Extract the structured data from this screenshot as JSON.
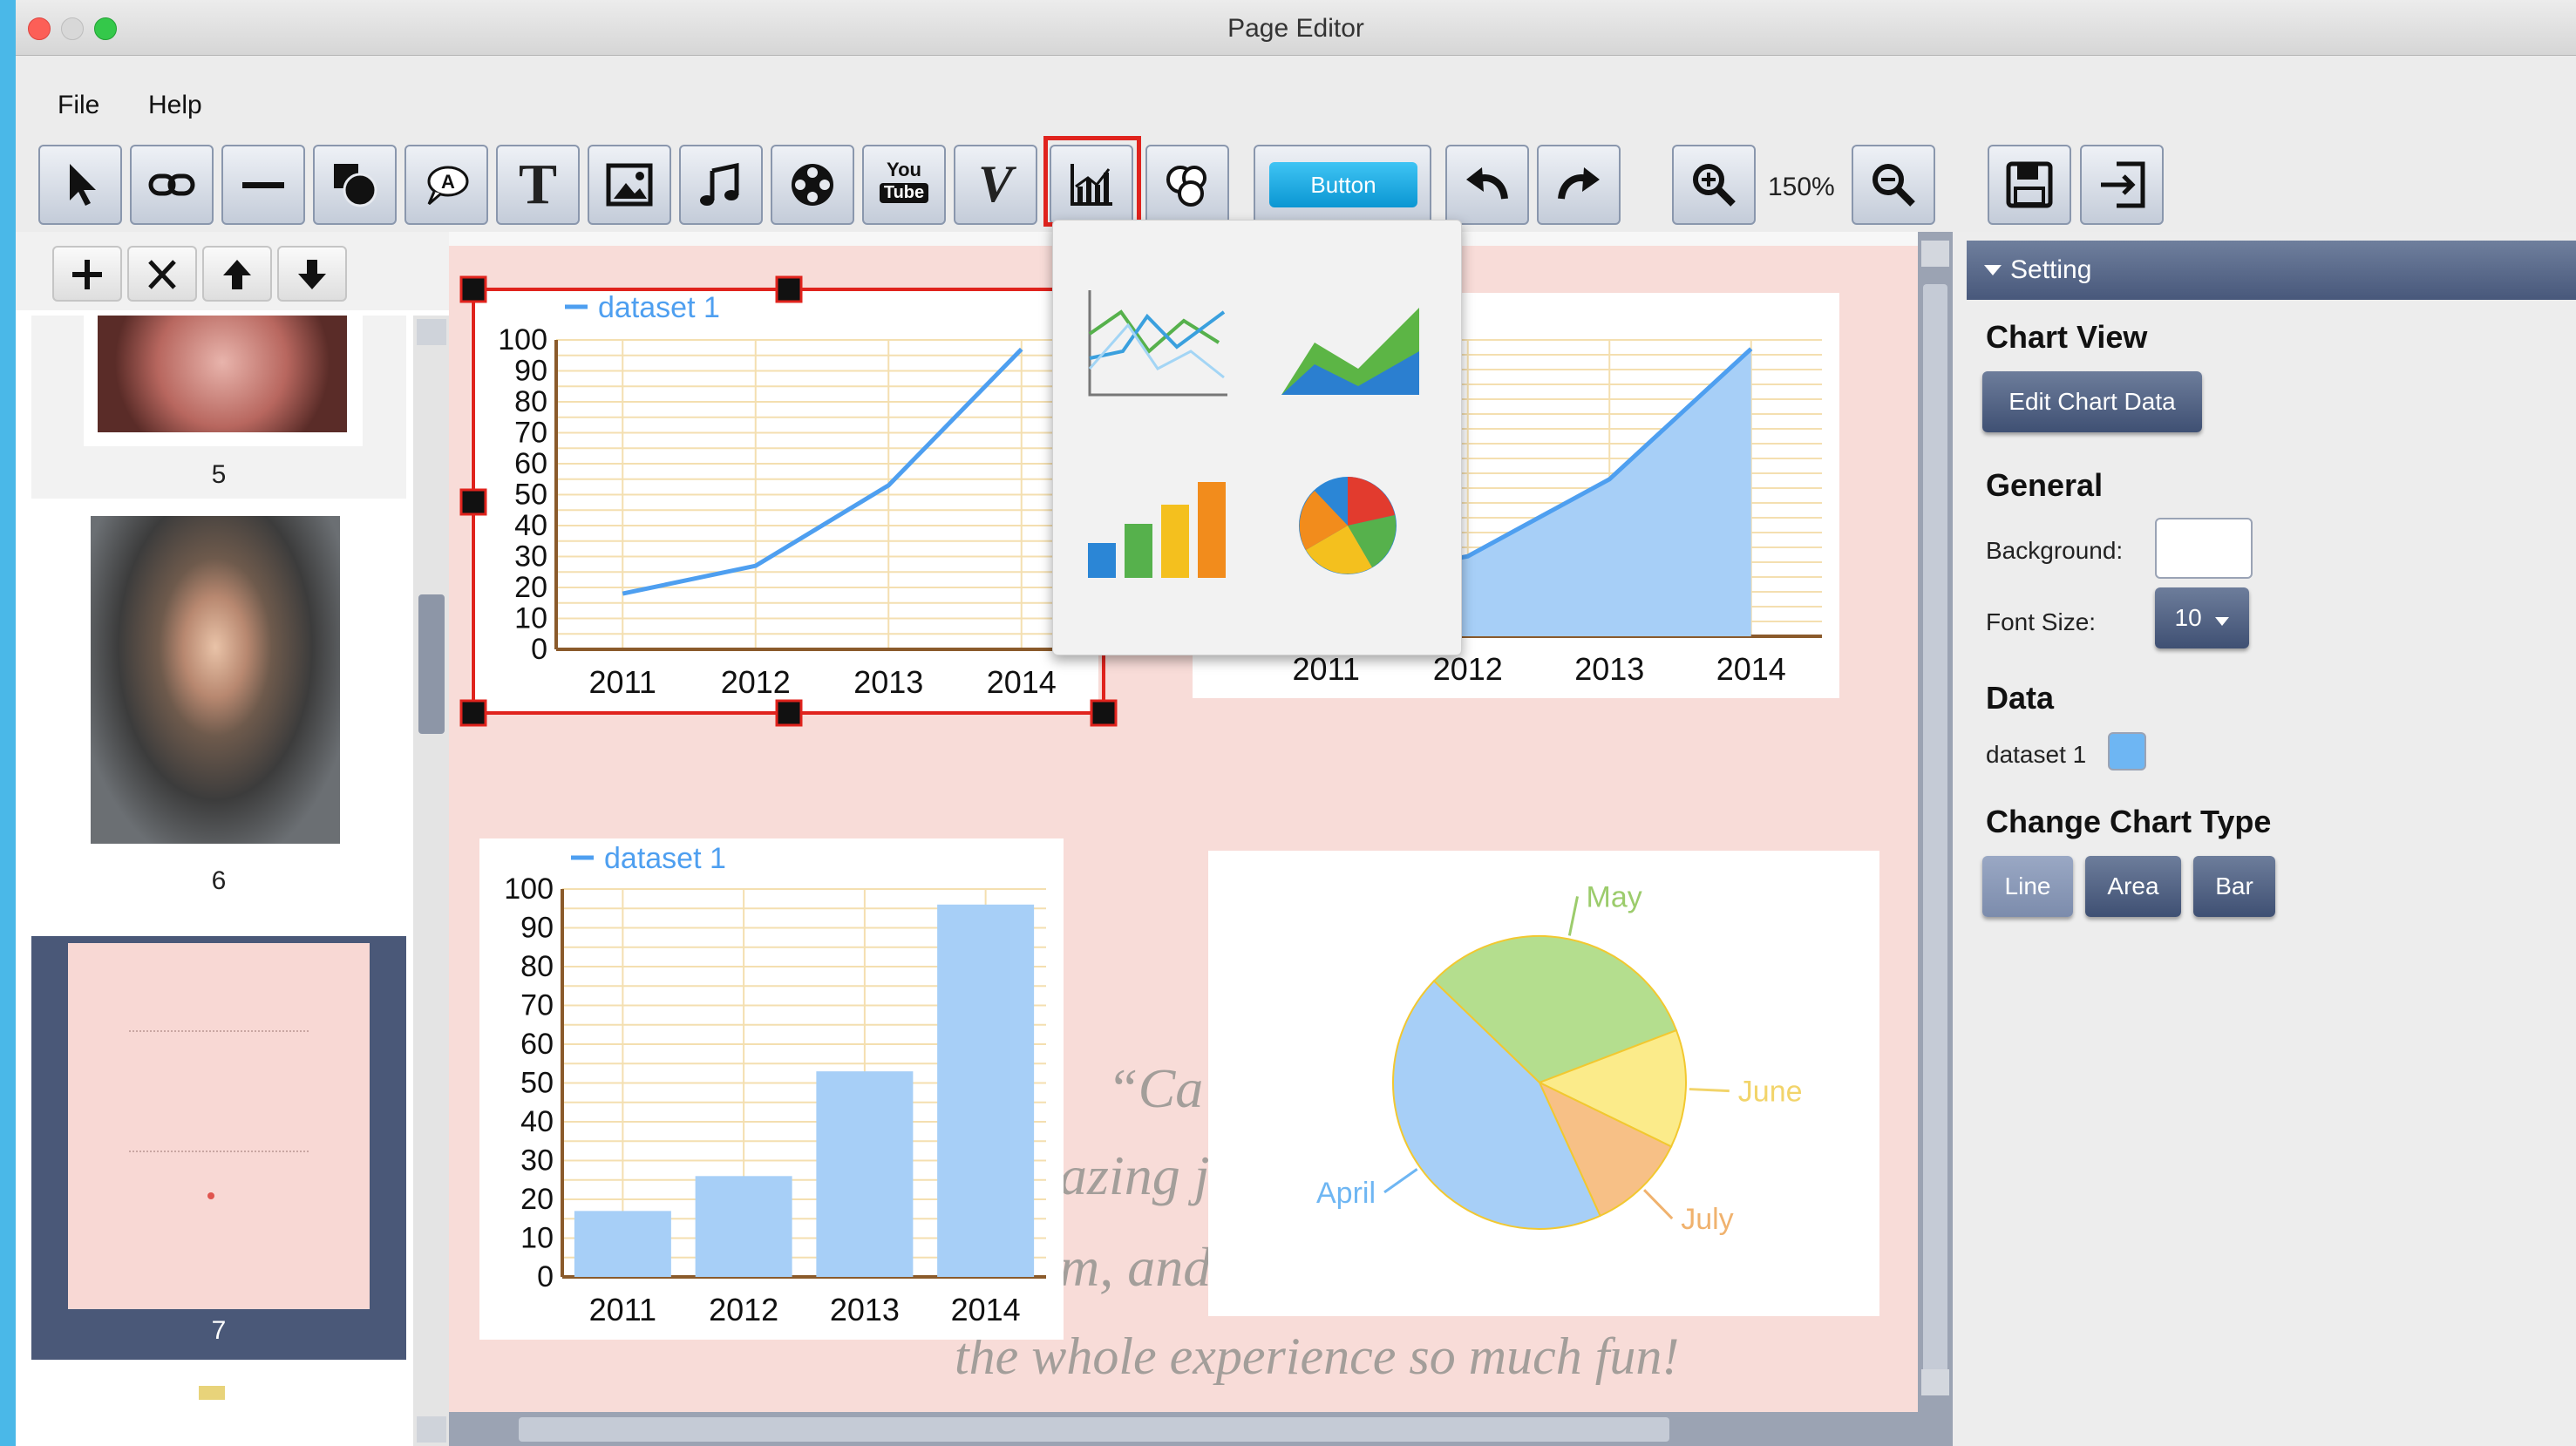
{
  "window": {
    "title": "Page Editor"
  },
  "menu": {
    "file": "File",
    "help": "Help"
  },
  "toolbar": {
    "icons": [
      "pointer-icon",
      "link-icon",
      "line-icon",
      "shapes-icon",
      "callout-icon",
      "text-icon",
      "image-icon",
      "music-icon",
      "video-icon",
      "youtube-icon",
      "vimeo-icon",
      "chart-icon",
      "stamp-icon",
      "button-widget",
      "undo-icon",
      "redo-icon",
      "zoom-in-icon",
      "zoom-out-icon",
      "save-icon",
      "export-icon"
    ],
    "youtube_text_top": "You",
    "youtube_text_bottom": "Tube",
    "vimeo_text": "V",
    "text_tool_glyph": "T",
    "button_label": "Button",
    "zoom_level": "150%"
  },
  "pages_panel": {
    "tools": [
      "add-icon",
      "delete-icon",
      "move-up-icon",
      "move-down-icon"
    ],
    "pages": [
      {
        "number": "5",
        "selected": false
      },
      {
        "number": "6",
        "selected": false
      },
      {
        "number": "7",
        "selected": true
      }
    ]
  },
  "canvas": {
    "background_text_1": "“Ca",
    "background_text_2": "azing jo",
    "background_text_3": "m, and",
    "background_text_4": "the whole experience so much fun!"
  },
  "chart_popup": {
    "options": [
      "line-chart-icon",
      "area-chart-icon",
      "bar-chart-icon",
      "pie-chart-icon"
    ]
  },
  "settings": {
    "header": "Setting",
    "chart_view": "Chart View",
    "edit_chart_data": "Edit Chart Data",
    "general": "General",
    "background_label": "Background:",
    "font_size_label": "Font Size:",
    "font_size_value": "10",
    "data_heading": "Data",
    "dataset_label": "dataset 1",
    "dataset_color": "#6eb6f3",
    "change_chart_type": "Change Chart Type",
    "types": [
      "Line",
      "Area",
      "Bar"
    ]
  },
  "chart_data": [
    {
      "type": "line",
      "categories": [
        "2011",
        "2012",
        "2013",
        "2014"
      ],
      "series": [
        {
          "name": "dataset 1",
          "values": [
            18,
            27,
            53,
            97
          ]
        }
      ],
      "ylim": [
        0,
        100
      ],
      "yticks": [
        0,
        10,
        20,
        30,
        40,
        50,
        60,
        70,
        80,
        90,
        100
      ]
    },
    {
      "type": "area",
      "categories": [
        "2011",
        "2012",
        "2013",
        "2014"
      ],
      "series": [
        {
          "values": [
            18,
            27,
            53,
            97
          ]
        }
      ],
      "ylim": [
        0,
        100
      ]
    },
    {
      "type": "bar",
      "categories": [
        "2011",
        "2012",
        "2013",
        "2014"
      ],
      "series": [
        {
          "name": "dataset 1",
          "values": [
            17,
            26,
            53,
            96
          ]
        }
      ],
      "ylim": [
        0,
        100
      ],
      "yticks": [
        0,
        10,
        20,
        30,
        40,
        50,
        60,
        70,
        80,
        90,
        100
      ]
    },
    {
      "type": "pie",
      "slices": [
        {
          "label": "May",
          "value": 32
        },
        {
          "label": "June",
          "value": 13
        },
        {
          "label": "July",
          "value": 11
        },
        {
          "label": "April",
          "value": 44
        }
      ]
    }
  ],
  "colors": {
    "accent": "#4e9ff0",
    "page": "#f8dcd8",
    "selection": "#e0231d"
  }
}
